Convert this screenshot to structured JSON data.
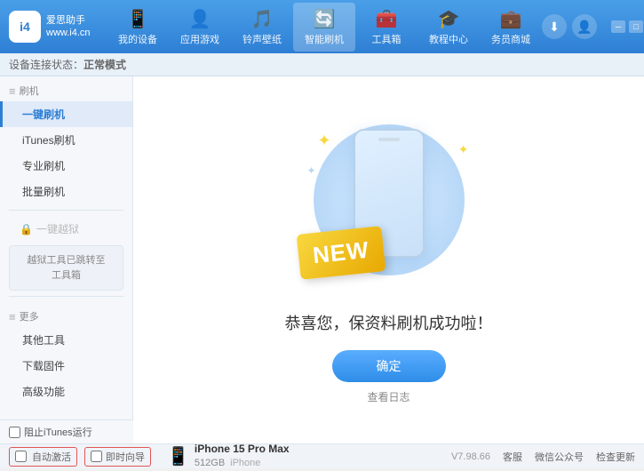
{
  "app": {
    "title": "爱思助手",
    "subtitle": "www.i4.cn",
    "logo_text": "i4"
  },
  "nav": {
    "items": [
      {
        "id": "my-device",
        "icon": "📱",
        "label": "我的设备"
      },
      {
        "id": "apps-games",
        "icon": "👤",
        "label": "应用游戏"
      },
      {
        "id": "ringtones",
        "icon": "🎵",
        "label": "铃声壁纸"
      },
      {
        "id": "smart-flash",
        "icon": "🔄",
        "label": "智能刷机",
        "active": true
      },
      {
        "id": "toolbox",
        "icon": "🧰",
        "label": "工具箱"
      },
      {
        "id": "tutorial",
        "icon": "🎓",
        "label": "教程中心"
      },
      {
        "id": "service",
        "icon": "💼",
        "label": "务员商城"
      }
    ]
  },
  "status": {
    "label": "设备连接状态：",
    "mode": "正常模式"
  },
  "sidebar": {
    "flash_section": "刷机",
    "items": [
      {
        "id": "one-key-flash",
        "label": "一键刷机",
        "active": true
      },
      {
        "id": "itunes-flash",
        "label": "iTunes刷机"
      },
      {
        "id": "pro-flash",
        "label": "专业刷机"
      },
      {
        "id": "batch-flash",
        "label": "批量刷机"
      }
    ],
    "one_key_jailbreak_disabled": "一键越狱",
    "jailbreak_notice": "越狱工具已跳转至\n工具箱",
    "more_section": "更多",
    "more_items": [
      {
        "id": "other-tools",
        "label": "其他工具"
      },
      {
        "id": "download-firmware",
        "label": "下载固件"
      },
      {
        "id": "advanced",
        "label": "高级功能"
      }
    ]
  },
  "content": {
    "new_badge": "NEW",
    "success_text": "恭喜您，保资料刷机成功啦！",
    "confirm_button": "确定",
    "log_link": "查看日志"
  },
  "bottom": {
    "auto_activate": "自动激活",
    "time_guide": "即时向导",
    "device_name": "iPhone 15 Pro Max",
    "device_storage": "512GB",
    "device_type": "iPhone",
    "itunes_stop": "阻止iTunes运行",
    "version": "V7.98.66",
    "links": [
      {
        "id": "client",
        "label": "客服"
      },
      {
        "id": "wechat",
        "label": "微信公众号"
      },
      {
        "id": "check-update",
        "label": "检查更新"
      }
    ]
  },
  "window_controls": {
    "minimize": "─",
    "maximize": "□",
    "close": "×"
  }
}
